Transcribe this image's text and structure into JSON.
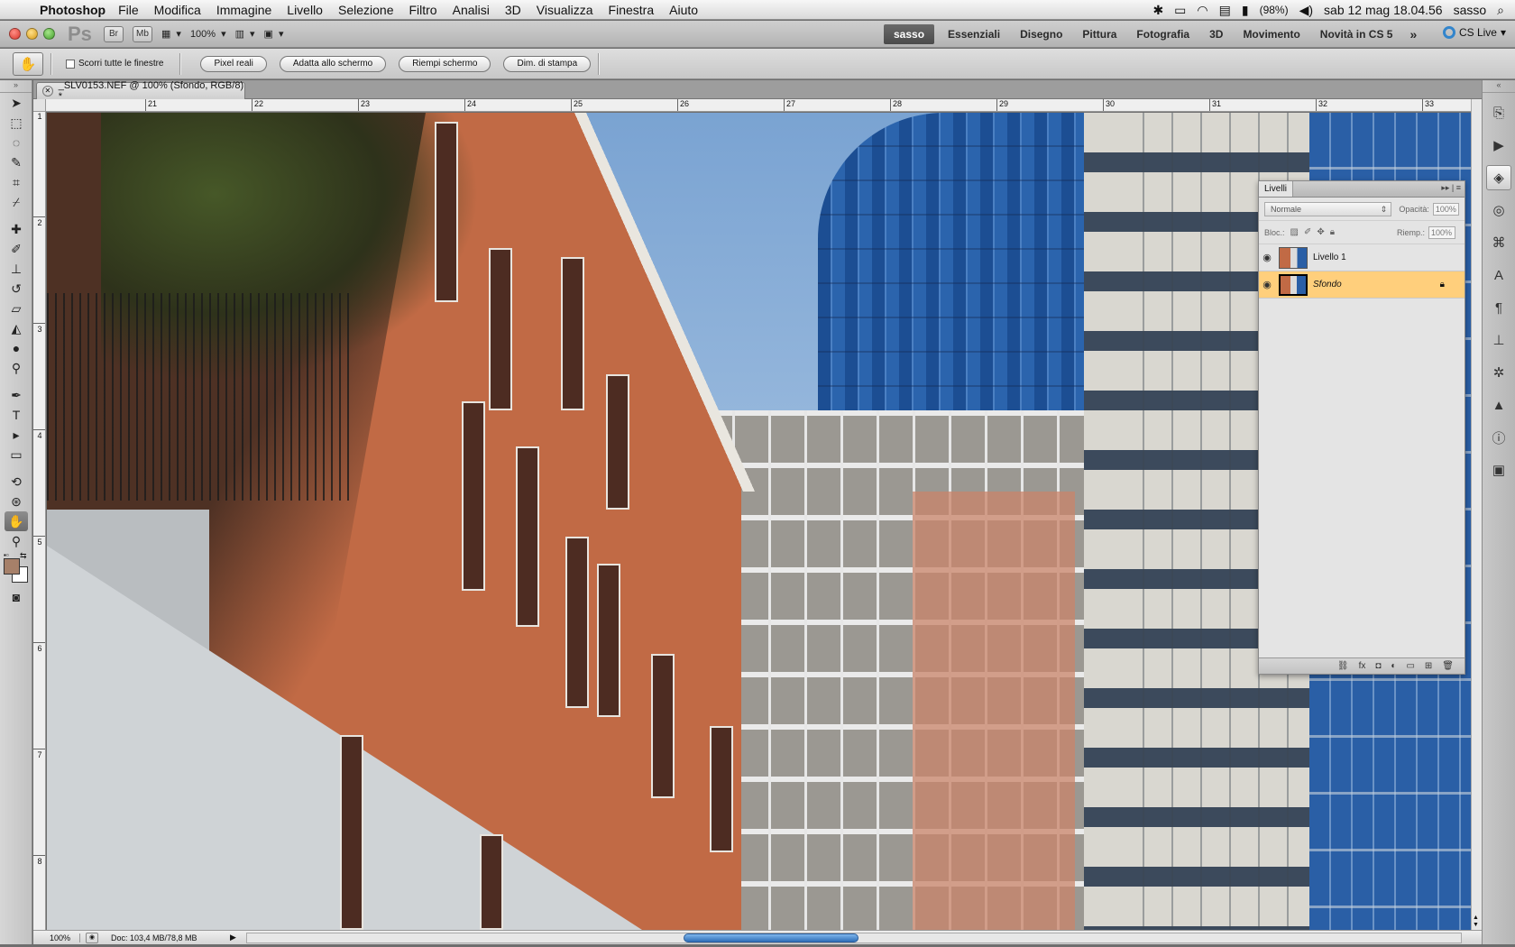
{
  "menubar": {
    "apple": "",
    "app_name": "Photoshop",
    "items": [
      "File",
      "Modifica",
      "Immagine",
      "Livello",
      "Selezione",
      "Filtro",
      "Analisi",
      "3D",
      "Visualizza",
      "Finestra",
      "Aiuto"
    ],
    "status": {
      "battery": "(98%)",
      "datetime": "sab 12 mag  18.04.56",
      "user": "sasso"
    }
  },
  "appbar": {
    "logo": "Ps",
    "bridge": "Br",
    "minibridge": "Mb",
    "zoom": "100%",
    "workspaces": [
      "sasso",
      "Essenziali",
      "Disegno",
      "Pittura",
      "Fotografia",
      "3D",
      "Movimento",
      "Novità in CS 5"
    ],
    "active_workspace": "sasso",
    "more": "»",
    "cs_live": "CS Live"
  },
  "options": {
    "scroll_all_label": "Scorri tutte le finestre",
    "buttons": [
      "Pixel reali",
      "Adatta allo schermo",
      "Riempi schermo",
      "Dim. di stampa"
    ]
  },
  "document": {
    "tab_title": "_SLV0153.NEF @ 100% (Sfondo, RGB/8) *",
    "ruler_top": [
      "21",
      "22",
      "23",
      "24",
      "25",
      "26",
      "27",
      "28",
      "29",
      "30",
      "31",
      "32",
      "33"
    ],
    "ruler_left": [
      "1",
      "2",
      "3",
      "4",
      "5",
      "6",
      "7",
      "8"
    ]
  },
  "layers_panel": {
    "title": "Livelli",
    "blend_mode": "Normale",
    "opacity_label": "Opacità:",
    "opacity_value": "100%",
    "lock_label": "Bloc.:",
    "fill_label": "Riemp.:",
    "fill_value": "100%",
    "layers": [
      {
        "name": "Livello 1",
        "visible": true,
        "selected": false,
        "locked": false
      },
      {
        "name": "Sfondo",
        "visible": true,
        "selected": true,
        "locked": true
      }
    ]
  },
  "statusbar": {
    "zoom": "100%",
    "doc_info": "Doc: 103,4 MB/78,8 MB"
  },
  "colors": {
    "foreground": "#a68069",
    "background": "#ffffff",
    "selection_highlight": "#ffcf7c",
    "scroll_thumb": "#2f6fb8"
  }
}
